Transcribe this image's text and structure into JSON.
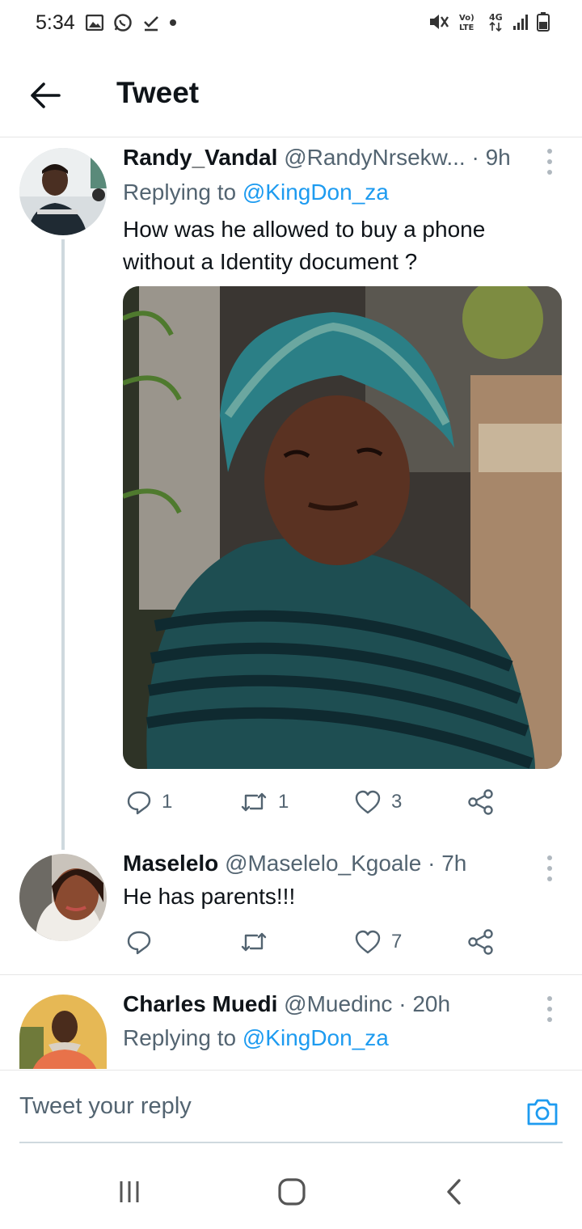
{
  "status_bar": {
    "time": "5:34",
    "network": "4G",
    "volte": "Vo) LTE"
  },
  "header": {
    "title": "Tweet"
  },
  "tweets": [
    {
      "name": "Randy_Vandal",
      "handle": "@RandyNrsekw...",
      "time": "· 9h",
      "replying_prefix": "Replying to ",
      "replying_to": "@KingDon_za",
      "text": "How was he allowed to buy a phone without a Identity document ?",
      "reply_count": "1",
      "retweet_count": "1",
      "like_count": "3"
    },
    {
      "name": "Maselelo",
      "handle": "@Maselelo_Kgoale",
      "time": "· 7h",
      "text": "He has parents!!!",
      "reply_count": "",
      "retweet_count": "",
      "like_count": "7"
    },
    {
      "name": "Charles Muedi",
      "handle": "@Muedinc",
      "time": "· 20h",
      "replying_prefix": "Replying to ",
      "replying_to": "@KingDon_za"
    }
  ],
  "reply_bar": {
    "placeholder": "Tweet your reply"
  },
  "colors": {
    "accent": "#1d9bf0",
    "muted": "#536471",
    "thread_line": "#cfd9de"
  },
  "icons": [
    "back-arrow-icon",
    "more-icon",
    "reply-icon",
    "retweet-icon",
    "like-icon",
    "share-icon",
    "camera-icon",
    "recent-apps-icon",
    "home-icon",
    "back-nav-icon"
  ]
}
